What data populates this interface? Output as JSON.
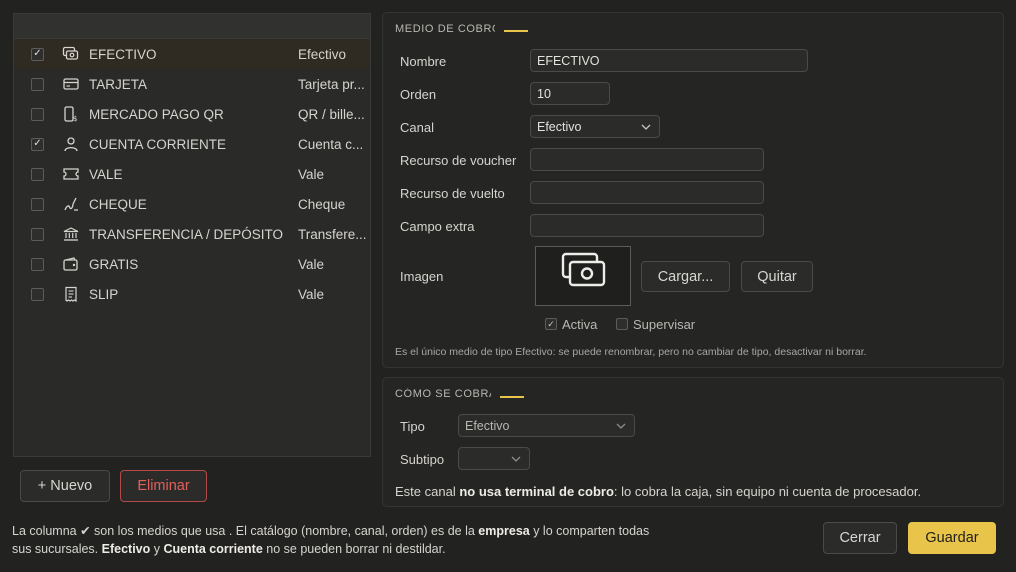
{
  "methods": [
    {
      "name": "EFECTIVO",
      "channel": "Efectivo",
      "checked": true,
      "selected": true,
      "icon": "cash-icon"
    },
    {
      "name": "TARJETA",
      "channel": "Tarjeta pr...",
      "checked": false,
      "selected": false,
      "icon": "card-icon"
    },
    {
      "name": "MERCADO PAGO QR",
      "channel": "QR / bille...",
      "checked": false,
      "selected": false,
      "icon": "phone-pay-icon"
    },
    {
      "name": "CUENTA CORRIENTE",
      "channel": "Cuenta c...",
      "checked": true,
      "selected": false,
      "icon": "user-icon"
    },
    {
      "name": "VALE",
      "channel": "Vale",
      "checked": false,
      "selected": false,
      "icon": "ticket-icon"
    },
    {
      "name": "CHEQUE",
      "channel": "Cheque",
      "checked": false,
      "selected": false,
      "icon": "cheque-icon"
    },
    {
      "name": "TRANSFERENCIA / DEPÓSITO",
      "channel": "Transfere...",
      "checked": false,
      "selected": false,
      "icon": "bank-icon"
    },
    {
      "name": "GRATIS",
      "channel": "Vale",
      "checked": false,
      "selected": false,
      "icon": "wallet-icon"
    },
    {
      "name": "SLIP",
      "channel": "Vale",
      "checked": false,
      "selected": false,
      "icon": "receipt-icon"
    }
  ],
  "buttons": {
    "new": "+ Nuevo",
    "delete": "Eliminar",
    "close": "Cerrar",
    "save": "Guardar",
    "load": "Cargar...",
    "remove": "Quitar"
  },
  "medio": {
    "title": "MEDIO DE COBRO",
    "nombre_label": "Nombre",
    "nombre_value": "EFECTIVO",
    "orden_label": "Orden",
    "orden_value": "10",
    "canal_label": "Canal",
    "canal_value": "Efectivo",
    "voucher_label": "Recurso de voucher",
    "voucher_value": "",
    "vuelto_label": "Recurso de vuelto",
    "vuelto_value": "",
    "extra_label": "Campo extra",
    "extra_value": "",
    "imagen_label": "Imagen",
    "activa_label": "Activa",
    "activa_checked": true,
    "supervisar_label": "Supervisar",
    "supervisar_checked": false,
    "note": "Es el único medio de tipo Efectivo: se puede renombrar, pero no cambiar de tipo, desactivar ni borrar."
  },
  "como": {
    "title": "CÓMO SE COBRA",
    "tipo_label": "Tipo",
    "tipo_value": "Efectivo",
    "subtipo_label": "Subtipo",
    "subtipo_value": "",
    "info_prefix": "Este canal ",
    "info_bold": "no usa terminal de cobro",
    "info_suffix": ": lo cobra la caja, sin equipo ni cuenta de procesador."
  },
  "footer": {
    "l1_a": "La columna ✔ son los medios que usa . El catálogo (nombre, canal, orden) es de la ",
    "l1_b": "empresa",
    "l1_c": " y lo comparten todas",
    "l2_a": "sus sucursales. ",
    "l2_b": "Efectivo",
    "l2_c": " y ",
    "l2_d": "Cuenta corriente",
    "l2_e": " no se pueden borrar ni destildar."
  },
  "colors": {
    "accent": "#e9c44a",
    "danger": "#e0605a",
    "background": "#222221"
  }
}
